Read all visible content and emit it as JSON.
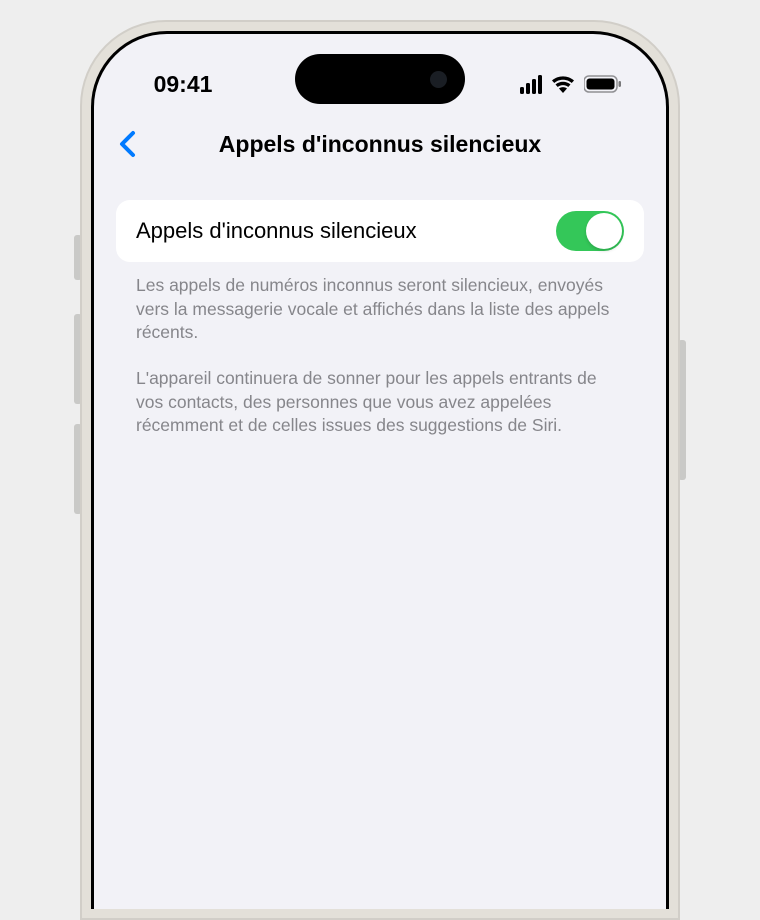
{
  "status_bar": {
    "time": "09:41"
  },
  "nav": {
    "title": "Appels d'inconnus silencieux"
  },
  "setting": {
    "label": "Appels d'inconnus silencieux",
    "toggle_on": true
  },
  "footer": {
    "paragraph1": "Les appels de numéros inconnus seront silencieux, envoyés vers la messagerie vocale et affichés dans la liste des appels récents.",
    "paragraph2": "L'appareil continuera de sonner pour les appels entrants de vos contacts, des personnes que vous avez appelées récemment et de celles issues des suggestions de Siri."
  }
}
